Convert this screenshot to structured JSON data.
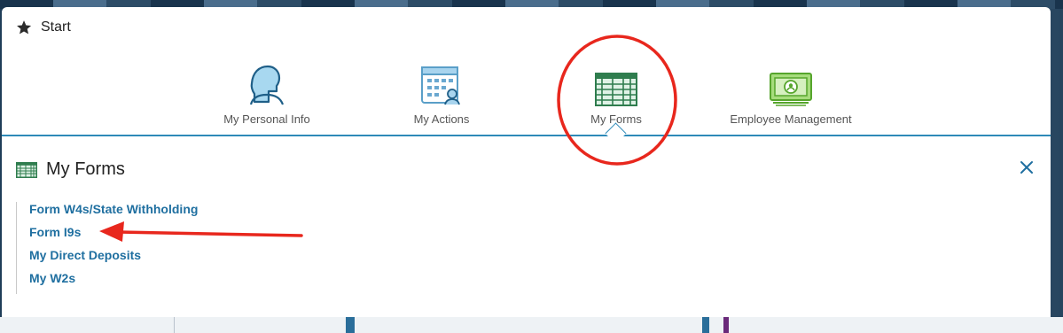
{
  "start": {
    "title": "Start",
    "star_icon": "star-icon"
  },
  "tiles": [
    {
      "label": "My Personal Info",
      "icon": "person-icon"
    },
    {
      "label": "My Actions",
      "icon": "calendar-actions-icon"
    },
    {
      "label": "My Forms",
      "icon": "forms-grid-icon",
      "selected": true
    },
    {
      "label": "Employee Management",
      "icon": "money-bill-icon"
    }
  ],
  "forms_panel": {
    "title": "My Forms",
    "icon": "forms-grid-icon",
    "close_icon": "close-icon",
    "links": [
      {
        "label": "Form W4s/State Withholding"
      },
      {
        "label": "Form I9s"
      },
      {
        "label": "My Direct Deposits"
      },
      {
        "label": "My W2s"
      }
    ]
  },
  "colors": {
    "accent": "#2e8ab8",
    "link": "#1f6fa0",
    "forms_green": "#3a8a5a",
    "money_green": "#6bbf3a",
    "annotation_red": "#e8271d"
  }
}
